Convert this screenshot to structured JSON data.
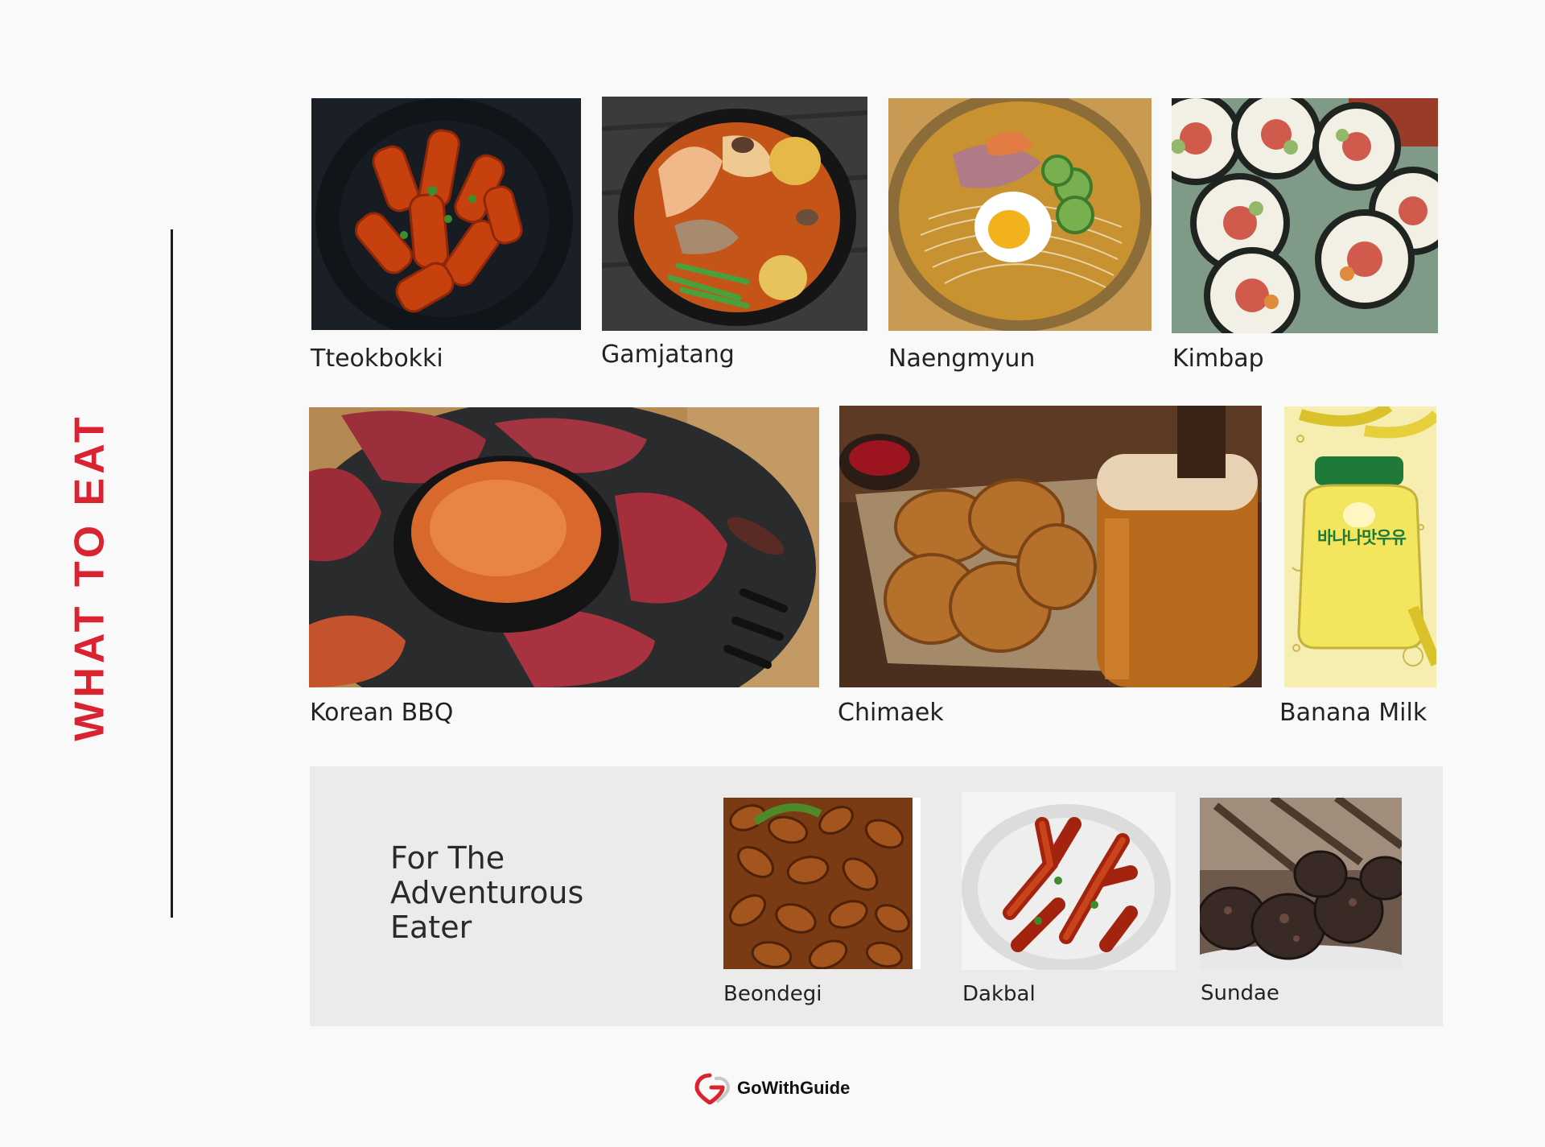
{
  "section_title": "WHAT TO EAT",
  "foods": [
    {
      "name": "Tteokbokki"
    },
    {
      "name": "Gamjatang"
    },
    {
      "name": "Naengmyun"
    },
    {
      "name": "Kimbap"
    },
    {
      "name": "Korean BBQ"
    },
    {
      "name": "Chimaek"
    },
    {
      "name": "Banana Milk",
      "package_text": "바나나맛우유"
    }
  ],
  "adventurous": {
    "title": "For The Adventurous Eater",
    "items": [
      {
        "name": "Beondegi"
      },
      {
        "name": "Dakbal"
      },
      {
        "name": "Sundae"
      }
    ]
  },
  "brand": {
    "name": "GoWithGuide",
    "color": "#d92331"
  },
  "colors": {
    "accent": "#d92331",
    "panel": "#ebebeb",
    "background": "#f9f9f9"
  }
}
